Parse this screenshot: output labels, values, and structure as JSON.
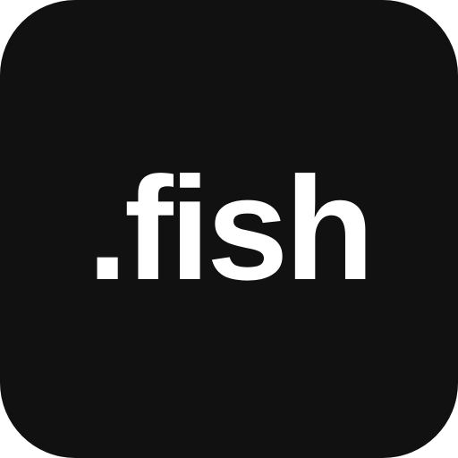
{
  "icon": {
    "wordmark": ".fish",
    "background_color": "#111111",
    "text_color": "#ffffff"
  }
}
